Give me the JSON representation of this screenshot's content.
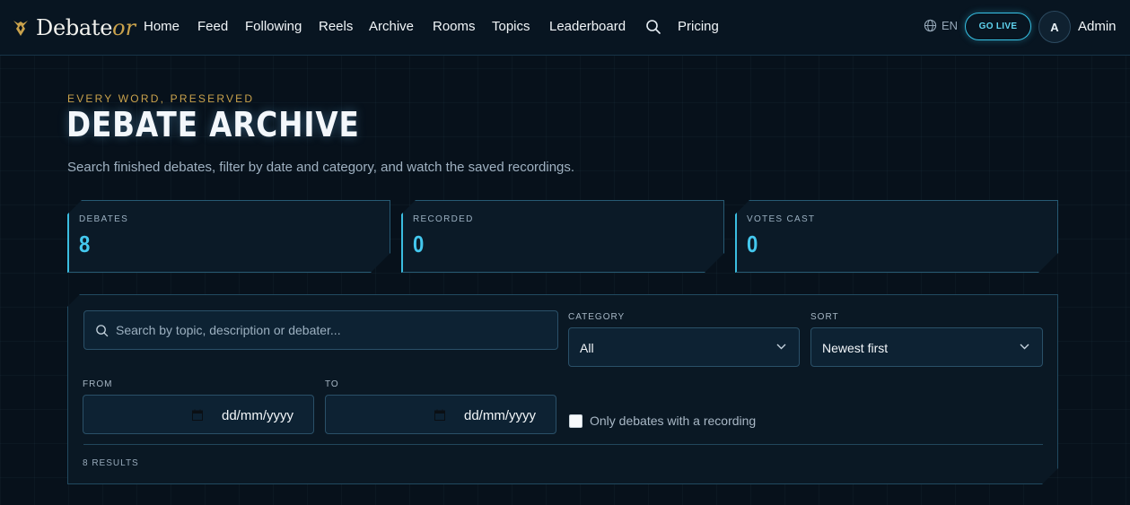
{
  "nav": {
    "brand": "Debate",
    "brand_accent": "or",
    "links": [
      "Home",
      "Feed",
      "Following",
      "Reels",
      "Archive",
      "Rooms",
      "Topics",
      "Leaderboard",
      "Pricing"
    ],
    "language": "EN",
    "go_live": "GO LIVE",
    "avatar_initial": "A",
    "username": "Admin"
  },
  "header": {
    "eyebrow": "EVERY WORD, PRESERVED",
    "title": "DEBATE ARCHIVE",
    "subtitle": "Search finished debates, filter by date and category, and watch the saved recordings."
  },
  "stats": [
    {
      "label": "DEBATES",
      "value": "8"
    },
    {
      "label": "RECORDED",
      "value": "0"
    },
    {
      "label": "VOTES CAST",
      "value": "0"
    }
  ],
  "filters": {
    "search_placeholder": "Search by topic, description or debater...",
    "category_label": "CATEGORY",
    "category_value": "All",
    "sort_label": "SORT",
    "sort_value": "Newest first",
    "from_label": "FROM",
    "from_value": "dd/mm/yyyy",
    "to_label": "TO",
    "to_value": "dd/mm/yyyy",
    "recording_only_label": "Only debates with a recording",
    "recording_only_checked": false,
    "results": "8 RESULTS"
  },
  "colors": {
    "accent_cyan": "#3bbde0",
    "accent_gold": "#c9a24c",
    "background": "#07111b"
  }
}
